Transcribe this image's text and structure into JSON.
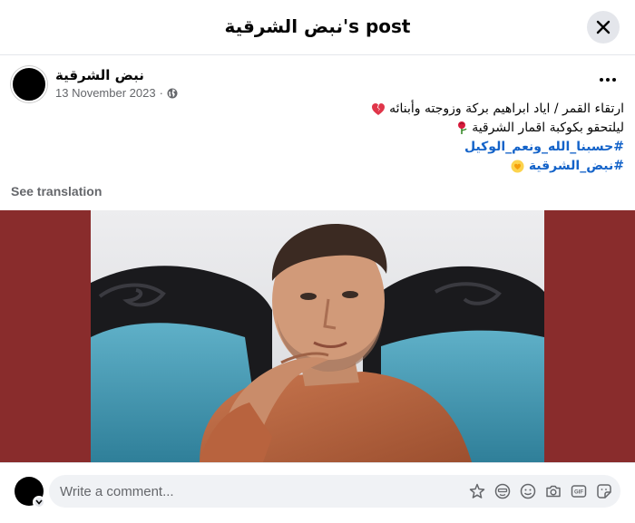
{
  "header": {
    "title": "نبض الشرقية's post"
  },
  "post": {
    "page_name": "نبض الشرقية",
    "date": "13 November 2023",
    "separator": "·",
    "audience_icon": "globe-icon",
    "lines": [
      "ارتقاء القمر / اياد ابراهيم بركة وزوجته وأبنائه",
      "ليلتحقو بكوكبة اقمار الشرقية"
    ],
    "hashtags": [
      "#حسبنا_الله_ونعم_الوكيل",
      "#نبض_الشرقية"
    ],
    "see_translation": "See translation"
  },
  "comment": {
    "placeholder": "Write a comment...",
    "icons": [
      "avatar-sticker-icon",
      "emoji-face-icon",
      "smiley-icon",
      "camera-icon",
      "gif-icon",
      "sticker-icon"
    ]
  },
  "colors": {
    "image_background": "#892c2c",
    "hashtag": "#1463c9",
    "secondary_text": "#65676b"
  }
}
